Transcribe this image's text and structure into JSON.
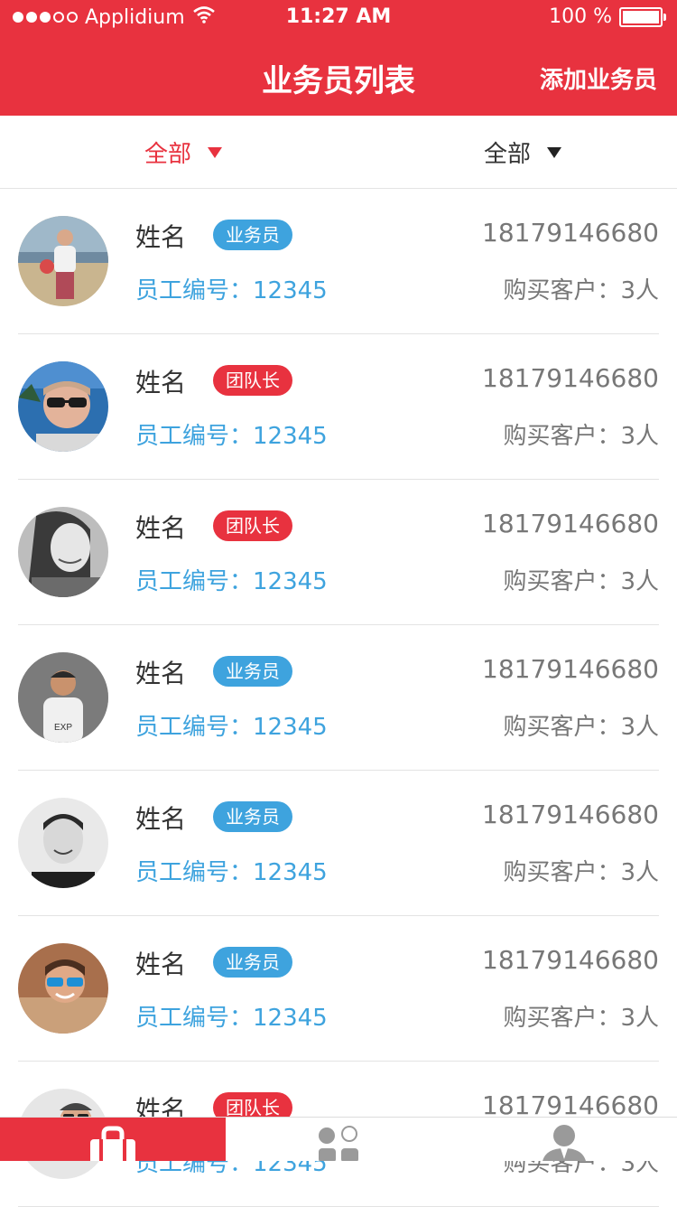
{
  "status_bar": {
    "carrier": "Applidium",
    "time": "11:27 AM",
    "battery": "100 %"
  },
  "nav": {
    "title": "业务员列表",
    "action": "添加业务员"
  },
  "filters": [
    {
      "label": "全部"
    },
    {
      "label": "全部"
    }
  ],
  "rows": [
    {
      "name": "姓名",
      "badge": "业务员",
      "badge_color": "#3ea3de",
      "employee": "员工编号：12345",
      "phone": "18179146680",
      "customers": "购买客户：3人"
    },
    {
      "name": "姓名",
      "badge": "团队长",
      "badge_color": "#e8323f",
      "employee": "员工编号：12345",
      "phone": "18179146680",
      "customers": "购买客户：3人"
    },
    {
      "name": "姓名",
      "badge": "团队长",
      "badge_color": "#e8323f",
      "employee": "员工编号：12345",
      "phone": "18179146680",
      "customers": "购买客户：3人"
    },
    {
      "name": "姓名",
      "badge": "业务员",
      "badge_color": "#3ea3de",
      "employee": "员工编号：12345",
      "phone": "18179146680",
      "customers": "购买客户：3人"
    },
    {
      "name": "姓名",
      "badge": "业务员",
      "badge_color": "#3ea3de",
      "employee": "员工编号：12345",
      "phone": "18179146680",
      "customers": "购买客户：3人"
    },
    {
      "name": "姓名",
      "badge": "业务员",
      "badge_color": "#3ea3de",
      "employee": "员工编号：12345",
      "phone": "18179146680",
      "customers": "购买客户：3人"
    },
    {
      "name": "姓名",
      "badge": "团队长",
      "badge_color": "#e8323f",
      "employee": "员工编号：12345",
      "phone": "18179146680",
      "customers": "购买客户：3人"
    }
  ],
  "tabbar": [
    {
      "icon": "briefcase-icon",
      "active": true
    },
    {
      "icon": "grid-icon",
      "active": false
    },
    {
      "icon": "user-icon",
      "active": false
    }
  ],
  "colors": {
    "accent": "#e8323f",
    "blue": "#3ea3de"
  }
}
